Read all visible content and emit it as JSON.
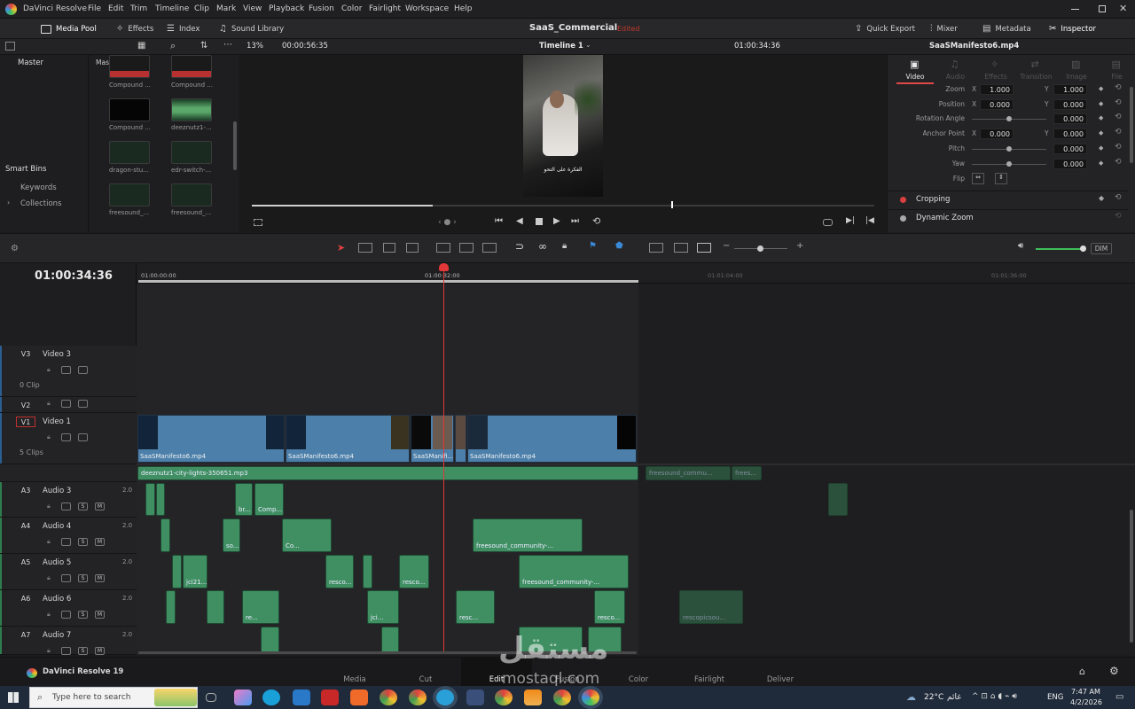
{
  "app": {
    "name": "DaVinci Resolve",
    "project_name": "SaaS_Commercial",
    "edited_label": "Edited",
    "menu": [
      "File",
      "Edit",
      "Trim",
      "Timeline",
      "Clip",
      "Mark",
      "View",
      "Playback",
      "Fusion",
      "Color",
      "Fairlight",
      "Workspace",
      "Help"
    ]
  },
  "toolbar": {
    "media_pool": "Media Pool",
    "effects": "Effects",
    "index": "Index",
    "sound_library": "Sound Library",
    "quick_export": "Quick Export",
    "mixer": "Mixer",
    "metadata": "Metadata",
    "inspector": "Inspector"
  },
  "viewer": {
    "zoom": "13%",
    "source_timecode": "00:00:56:35",
    "timeline_name": "Timeline 1",
    "record_timecode": "01:00:34:36",
    "clip_name": "SaaSManifesto6.mp4",
    "overlay_text": "الفكرة على التحو",
    "scrub_progress": 0.29
  },
  "media_pool": {
    "master_label": "Master",
    "bin_header": "Master",
    "smart_bins": "Smart Bins",
    "keywords": "Keywords",
    "collections": "Collections",
    "thumbs": [
      {
        "caption": "Compound ...",
        "kind": "compound-red"
      },
      {
        "caption": "Compound ...",
        "kind": "compound-red"
      },
      {
        "caption": "Compound ...",
        "kind": "compound-black"
      },
      {
        "caption": "deeznutz1-...",
        "kind": "audio-green"
      },
      {
        "caption": "dragon-stu...",
        "kind": "audio-sparse"
      },
      {
        "caption": "edr-switch-...",
        "kind": "audio-sparse"
      },
      {
        "caption": "freesound_...",
        "kind": "audio-sparse"
      },
      {
        "caption": "freesound_...",
        "kind": "audio-sparse"
      }
    ]
  },
  "inspector": {
    "tabs": [
      "Video",
      "Audio",
      "Effects",
      "Transition",
      "Image",
      "File"
    ],
    "active_tab": "Video",
    "rows": [
      {
        "label": "Zoom",
        "x": "1.000",
        "y": "1.000",
        "has_xy": true
      },
      {
        "label": "Position",
        "x": "0.000",
        "y": "0.000",
        "has_xy": true
      },
      {
        "label": "Rotation Angle",
        "value": "0.000",
        "has_xy": false
      },
      {
        "label": "Anchor Point",
        "x": "0.000",
        "y": "0.000",
        "has_xy": true
      },
      {
        "label": "Pitch",
        "value": "0.000",
        "has_xy": false
      },
      {
        "label": "Yaw",
        "value": "0.000",
        "has_xy": false
      }
    ],
    "x_label": "X",
    "y_label": "Y",
    "flip_label": "Flip",
    "sections": [
      "Cropping",
      "Dynamic Zoom"
    ]
  },
  "timeline": {
    "timecode": "01:00:34:36",
    "ruler": [
      "01:00:00:00",
      "01:00:32:00",
      "01:01:04:00",
      "01:01:36:00"
    ],
    "dim_label": "DIM",
    "tracks": [
      {
        "id": "V3",
        "name": "Video 3",
        "clips": "0 Clip"
      },
      {
        "id": "V2",
        "name": "",
        "clips": ""
      },
      {
        "id": "V1",
        "name": "Video 1",
        "clips": "5 Clips"
      },
      {
        "id": "A3",
        "name": "Audio 3",
        "level": "2.0"
      },
      {
        "id": "A4",
        "name": "Audio 4",
        "level": "2.0"
      },
      {
        "id": "A5",
        "name": "Audio 5",
        "level": "2.0"
      },
      {
        "id": "A6",
        "name": "Audio 6",
        "level": "2.0"
      },
      {
        "id": "A7",
        "name": "Audio 7",
        "level": "2.0"
      }
    ],
    "video_clips": [
      "SaaSManifesto6.mp4",
      "SaaSManifesto6.mp4",
      "SaaSManifi...",
      "SaaSManifesto6.mp4"
    ],
    "audio_clips": {
      "music": "deeznutz1-city-lights-350651.mp3",
      "fs1": "freesound_commu...",
      "fs2": "frees...",
      "a3a": "br...",
      "a3b": "Comp...",
      "a4a": "so...",
      "a4b": "Co...",
      "a4c": "freesound_community-...",
      "a5a": "jci21...",
      "a5b": "resco...",
      "a5c": "resco...",
      "a5d": "freesound_community-...",
      "a6a": "re...",
      "a6b": "jci...",
      "a6c": "resc...",
      "a6d": "resco...",
      "a6e": "rescopicsou..."
    }
  },
  "pages": [
    "Media",
    "Cut",
    "Edit",
    "Fusion",
    "Color",
    "Fairlight",
    "Deliver"
  ],
  "active_page": "Edit",
  "resolve_version": "DaVinci Resolve 19",
  "watermark": {
    "arabic": "مستقل",
    "latin": "mostaql.com"
  },
  "taskbar": {
    "search_placeholder": "Type here to search",
    "weather": "22°C",
    "weather_label": "غائم",
    "lang": "ENG",
    "time": "7:47 AM",
    "date": "4/2/2026"
  }
}
